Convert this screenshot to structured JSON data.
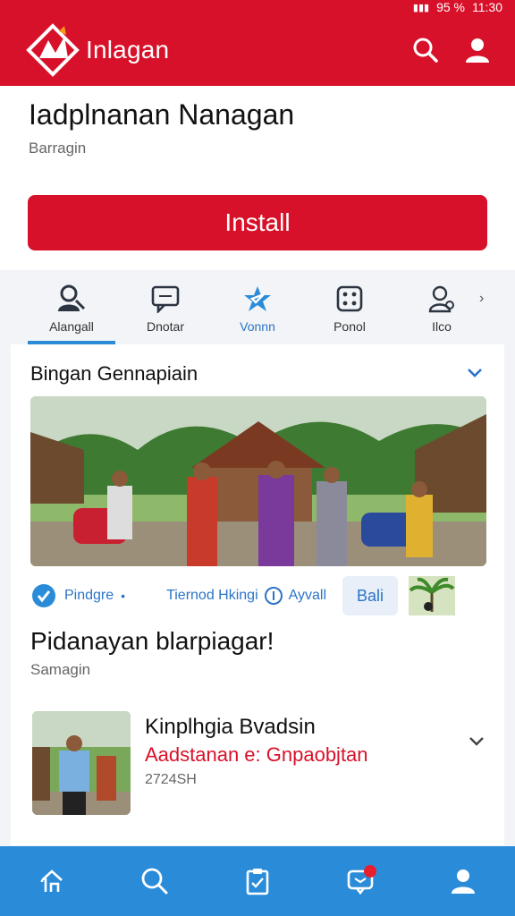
{
  "status_bar": {
    "battery": "95 %",
    "time": "11:30"
  },
  "app": {
    "title": "Inlagan"
  },
  "hero": {
    "title": "Iadplnanan Nanagan",
    "subtitle": "Barragin",
    "install_label": "Install"
  },
  "tabs": [
    {
      "label": "Alangall",
      "icon": "person-search-icon"
    },
    {
      "label": "Dnotar",
      "icon": "chat-icon"
    },
    {
      "label": "Vonnn",
      "icon": "star-badge-icon"
    },
    {
      "label": "Ponol",
      "icon": "grid-dots-icon"
    },
    {
      "label": "Ilco",
      "icon": "profile-settings-icon"
    }
  ],
  "card": {
    "title": "Bingan Gennapiain",
    "meta": {
      "verified_label": "Pindgre",
      "middle_label": "Tiernod Hkingi",
      "right_label": "Ayvall",
      "chip_label": "Bali"
    },
    "section_title": "Pidanayan blarpiagar!",
    "section_subtitle": "Samagin",
    "list_item": {
      "title": "Kinplhgia Bvadsin",
      "subtitle": "Aadstanan e: Gnpaobjtan",
      "meta": "2724SH"
    }
  },
  "bottom_nav": [
    {
      "name": "home",
      "icon": "home-icon"
    },
    {
      "name": "search",
      "icon": "search-icon"
    },
    {
      "name": "clipboard",
      "icon": "clipboard-icon"
    },
    {
      "name": "messages",
      "icon": "message-icon"
    },
    {
      "name": "profile",
      "icon": "profile-icon"
    }
  ],
  "colors": {
    "brand_red": "#d8112a",
    "accent_blue": "#2a8cd8",
    "link_blue": "#2a74c8"
  }
}
